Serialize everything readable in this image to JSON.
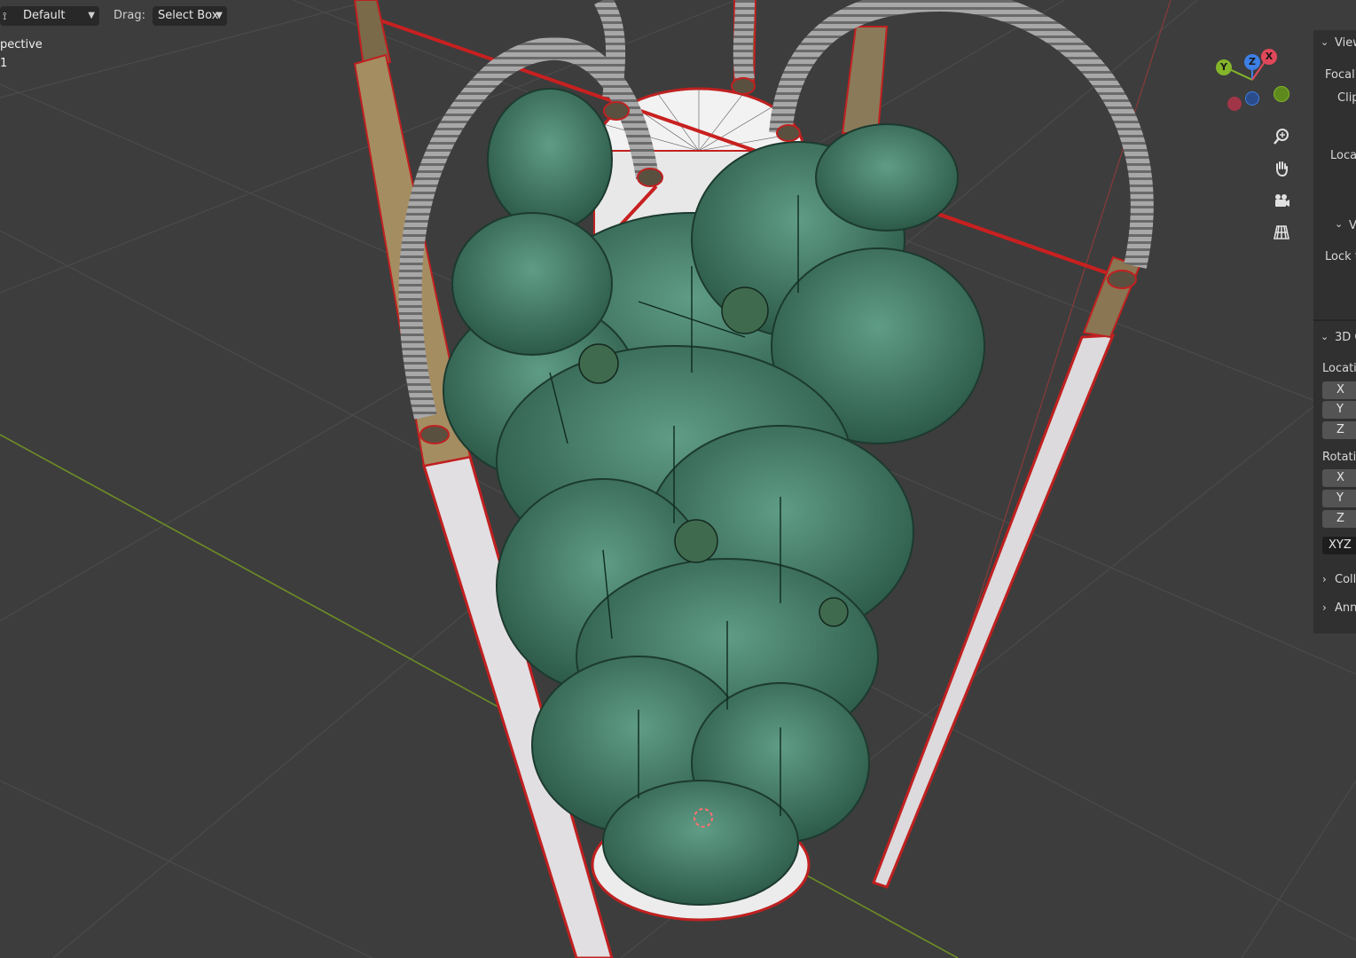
{
  "header": {
    "transform_orientation": "Default",
    "drag_label": "Drag:",
    "drag_value": "Select Box"
  },
  "viewport": {
    "view_name": "pective",
    "collection_line": "1"
  },
  "gizmo": {
    "axis_x": "X",
    "axis_y": "Y",
    "axis_z": "Z",
    "color_x": "#e0485a",
    "color_y": "#84b52a",
    "color_z": "#3d7fe6"
  },
  "nav_tools": [
    {
      "icon": "zoom-icon"
    },
    {
      "icon": "hand-pan-icon"
    },
    {
      "icon": "camera-icon"
    },
    {
      "icon": "grid-ortho-icon"
    }
  ],
  "npanel": {
    "view_header": "View",
    "focal": "Focal",
    "clip": "Clip",
    "local": "Loca",
    "view_lock_header": "V",
    "lock": "Lock t",
    "cursor_header": "3D C",
    "location": "Locatio",
    "loc_x": "X",
    "loc_y": "Y",
    "loc_z": "Z",
    "rotation": "Rotatio",
    "rot_x": "X",
    "rot_y": "Y",
    "rot_z": "Z",
    "rotation_mode": "XYZ E",
    "collections": "Coll",
    "annotations": "Ann"
  },
  "colors": {
    "viewport_bg": "#3d3d3d",
    "selection_outline": "#d22a2a",
    "foliage": "#3f7a63",
    "grid_line": "#4a4a4a",
    "x_axis_line": "#7a9a2a",
    "panel_bg": "#303030"
  }
}
